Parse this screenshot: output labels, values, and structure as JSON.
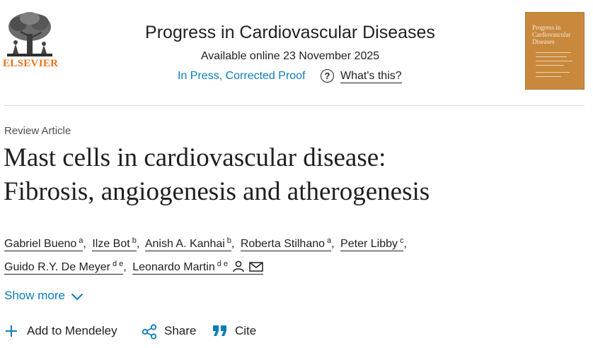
{
  "header": {
    "publisher": "ELSEVIER",
    "journal_title": "Progress in Cardiovascular Diseases",
    "available": "Available online 23 November 2025",
    "status_link": "In Press, Corrected Proof",
    "help_icon": "question-circle-icon",
    "whats_this": "What's this?",
    "cover_title_line1": "Progress in",
    "cover_title_line2": "Cardiovascular",
    "cover_title_line3": "Diseases"
  },
  "article": {
    "type": "Review Article",
    "title_line1": "Mast cells in cardiovascular disease:",
    "title_line2": "Fibrosis, angiogenesis and atherogenesis",
    "authors": [
      {
        "name": "Gabriel Bueno",
        "aff": "a"
      },
      {
        "name": "Ilze Bot",
        "aff": "b"
      },
      {
        "name": "Anish A. Kanhai",
        "aff": "b"
      },
      {
        "name": "Roberta Stilhano",
        "aff": "a"
      },
      {
        "name": "Peter Libby",
        "aff": "c"
      },
      {
        "name": "Guido R.Y. De Meyer",
        "aff": "d e"
      },
      {
        "name": "Leonardo Martin",
        "aff": "d e"
      }
    ],
    "separator": ",",
    "show_more": "Show more"
  },
  "actions": {
    "add_mendeley": "Add to Mendeley",
    "share": "Share",
    "cite": "Cite"
  },
  "colors": {
    "link": "#0c7dbb",
    "elsevier_orange": "#e9711c",
    "cover": "#c9893d"
  }
}
